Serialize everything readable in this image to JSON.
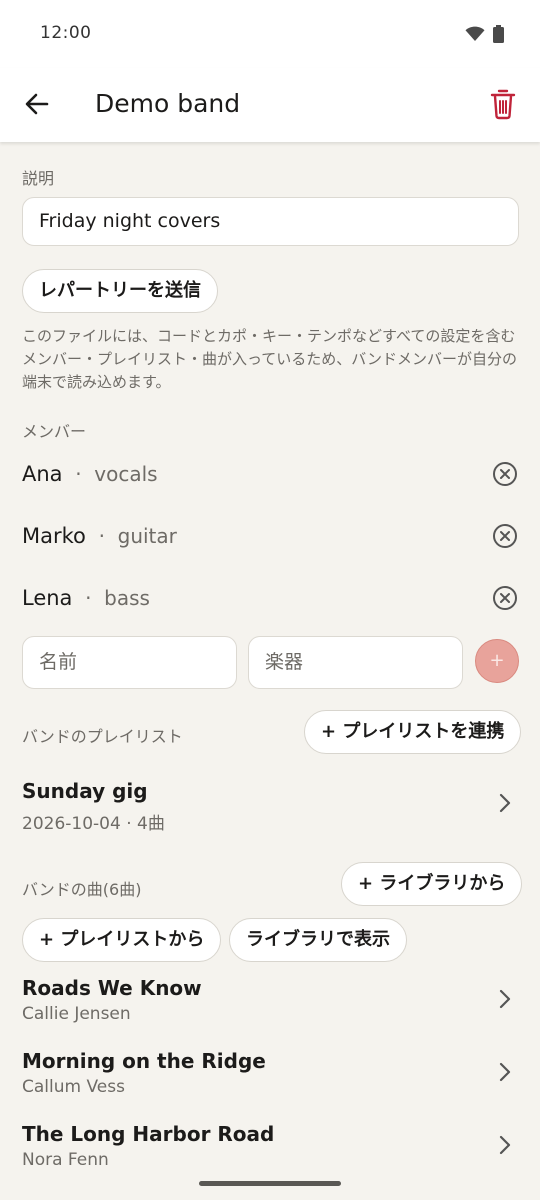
{
  "status_bar": {
    "time": "12:00"
  },
  "app_bar": {
    "title": "Demo band"
  },
  "description": {
    "label": "説明",
    "value": "Friday night covers"
  },
  "send_repertoire_label": "レパートリーを送信",
  "help_text": "このファイルには、コードとカポ・キー・テンポなどすべての設定を含むメンバー・プレイリスト・曲が入っているため、バンドメンバーが自分の端末で読み込めます。",
  "members": {
    "label": "メンバー",
    "items": [
      {
        "name": "Ana",
        "separator": "·",
        "role": "vocals"
      },
      {
        "name": "Marko",
        "separator": "·",
        "role": "guitar"
      },
      {
        "name": "Lena",
        "separator": "·",
        "role": "bass"
      }
    ],
    "name_placeholder": "名前",
    "instrument_placeholder": "楽器",
    "add_symbol": "+"
  },
  "playlists": {
    "label": "バンドのプレイリスト",
    "link_button": "+ プレイリストを連携",
    "items": [
      {
        "title": "Sunday gig",
        "subtitle": "2026-10-04 · 4曲"
      }
    ]
  },
  "songs": {
    "label": "バンドの曲(6曲)",
    "from_library_button": "+ ライブラリから",
    "from_playlist_button": "+ プレイリストから",
    "show_in_library_button": "ライブラリで表示",
    "items": [
      {
        "title": "Roads We Know",
        "artist": "Callie Jensen"
      },
      {
        "title": "Morning on the Ridge",
        "artist": "Callum Vess"
      },
      {
        "title": "The Long Harbor Road",
        "artist": "Nora Fenn"
      }
    ]
  },
  "icons": {
    "back": "arrow-left-icon",
    "delete": "trash-icon",
    "remove": "close-circle-icon",
    "chevron": "chevron-right-icon",
    "wifi": "wifi-icon",
    "battery": "battery-icon"
  },
  "colors": {
    "accent": "#c0243a",
    "background": "#f5f3ee",
    "add_button": "#e8a39b"
  }
}
